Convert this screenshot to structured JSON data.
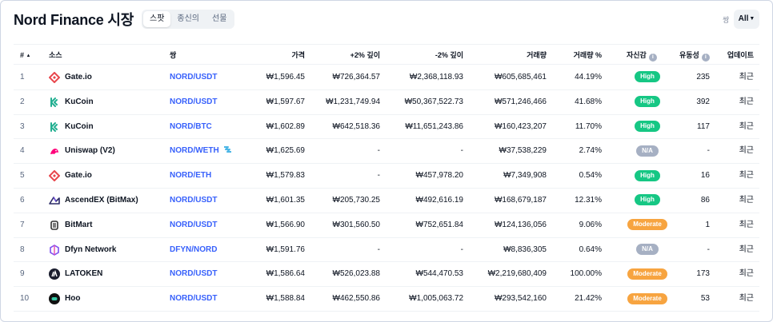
{
  "header": {
    "title": "Nord Finance 시장",
    "tabs": [
      {
        "label": "스팟",
        "active": true
      },
      {
        "label": "종신의",
        "active": false
      },
      {
        "label": "선물",
        "active": false
      }
    ],
    "pair_filter_label": "쌍",
    "pair_filter_value": "All"
  },
  "columns": {
    "rank": "#",
    "source": "소스",
    "pair": "쌍",
    "price": "가격",
    "depth_plus": "+2% 깊이",
    "depth_minus": "-2% 깊이",
    "volume": "거래량",
    "volume_pct": "거래량 %",
    "confidence": "자신감",
    "liquidity": "유동성",
    "updated": "업데이트"
  },
  "colors": {
    "high": "#16c784",
    "moderate": "#f7a440",
    "na": "#a6b0c3",
    "link": "#3861fb"
  },
  "rows": [
    {
      "rank": "1",
      "source": "Gate.io",
      "logo": "gate-logo",
      "pair": "NORD/USDT",
      "price": "₩1,596.45",
      "depth_plus": "₩726,364.57",
      "depth_minus": "₩2,368,118.93",
      "volume": "₩605,685,461",
      "volume_pct": "44.19%",
      "confidence": "High",
      "liquidity": "235",
      "updated": "최근"
    },
    {
      "rank": "2",
      "source": "KuCoin",
      "logo": "kucoin-logo",
      "pair": "NORD/USDT",
      "price": "₩1,597.67",
      "depth_plus": "₩1,231,749.94",
      "depth_minus": "₩50,367,522.73",
      "volume": "₩571,246,466",
      "volume_pct": "41.68%",
      "confidence": "High",
      "liquidity": "392",
      "updated": "최근"
    },
    {
      "rank": "3",
      "source": "KuCoin",
      "logo": "kucoin-logo",
      "pair": "NORD/BTC",
      "price": "₩1,602.89",
      "depth_plus": "₩642,518.36",
      "depth_minus": "₩11,651,243.86",
      "volume": "₩160,423,207",
      "volume_pct": "11.70%",
      "confidence": "High",
      "liquidity": "117",
      "updated": "최근"
    },
    {
      "rank": "4",
      "source": "Uniswap (V2)",
      "logo": "uniswap-logo",
      "pair": "NORD/WETH",
      "price": "₩1,625.69",
      "depth_plus": "-",
      "depth_minus": "-",
      "volume": "₩37,538,229",
      "volume_pct": "2.74%",
      "confidence": "N/A",
      "liquidity": "-",
      "updated": "최근"
    },
    {
      "rank": "5",
      "source": "Gate.io",
      "logo": "gate-logo",
      "pair": "NORD/ETH",
      "price": "₩1,579.83",
      "depth_plus": "-",
      "depth_minus": "₩457,978.20",
      "volume": "₩7,349,908",
      "volume_pct": "0.54%",
      "confidence": "High",
      "liquidity": "16",
      "updated": "최근"
    },
    {
      "rank": "6",
      "source": "AscendEX (BitMax)",
      "logo": "ascendex-logo",
      "pair": "NORD/USDT",
      "price": "₩1,601.35",
      "depth_plus": "₩205,730.25",
      "depth_minus": "₩492,616.19",
      "volume": "₩168,679,187",
      "volume_pct": "12.31%",
      "confidence": "High",
      "liquidity": "86",
      "updated": "최근"
    },
    {
      "rank": "7",
      "source": "BitMart",
      "logo": "bitmart-logo",
      "pair": "NORD/USDT",
      "price": "₩1,566.90",
      "depth_plus": "₩301,560.50",
      "depth_minus": "₩752,651.84",
      "volume": "₩124,136,056",
      "volume_pct": "9.06%",
      "confidence": "Moderate",
      "liquidity": "1",
      "updated": "최근"
    },
    {
      "rank": "8",
      "source": "Dfyn Network",
      "logo": "dfyn-logo",
      "pair": "DFYN/NORD",
      "price": "₩1,591.76",
      "depth_plus": "-",
      "depth_minus": "-",
      "volume": "₩8,836,305",
      "volume_pct": "0.64%",
      "confidence": "N/A",
      "liquidity": "-",
      "updated": "최근"
    },
    {
      "rank": "9",
      "source": "LATOKEN",
      "logo": "latoken-logo",
      "pair": "NORD/USDT",
      "price": "₩1,586.64",
      "depth_plus": "₩526,023.88",
      "depth_minus": "₩544,470.53",
      "volume": "₩2,219,680,409",
      "volume_pct": "100.00%",
      "confidence": "Moderate",
      "liquidity": "173",
      "updated": "최근"
    },
    {
      "rank": "10",
      "source": "Hoo",
      "logo": "hoo-logo",
      "pair": "NORD/USDT",
      "price": "₩1,588.84",
      "depth_plus": "₩462,550.86",
      "depth_minus": "₩1,005,063.72",
      "volume": "₩293,542,160",
      "volume_pct": "21.42%",
      "confidence": "Moderate",
      "liquidity": "53",
      "updated": "최근"
    }
  ]
}
